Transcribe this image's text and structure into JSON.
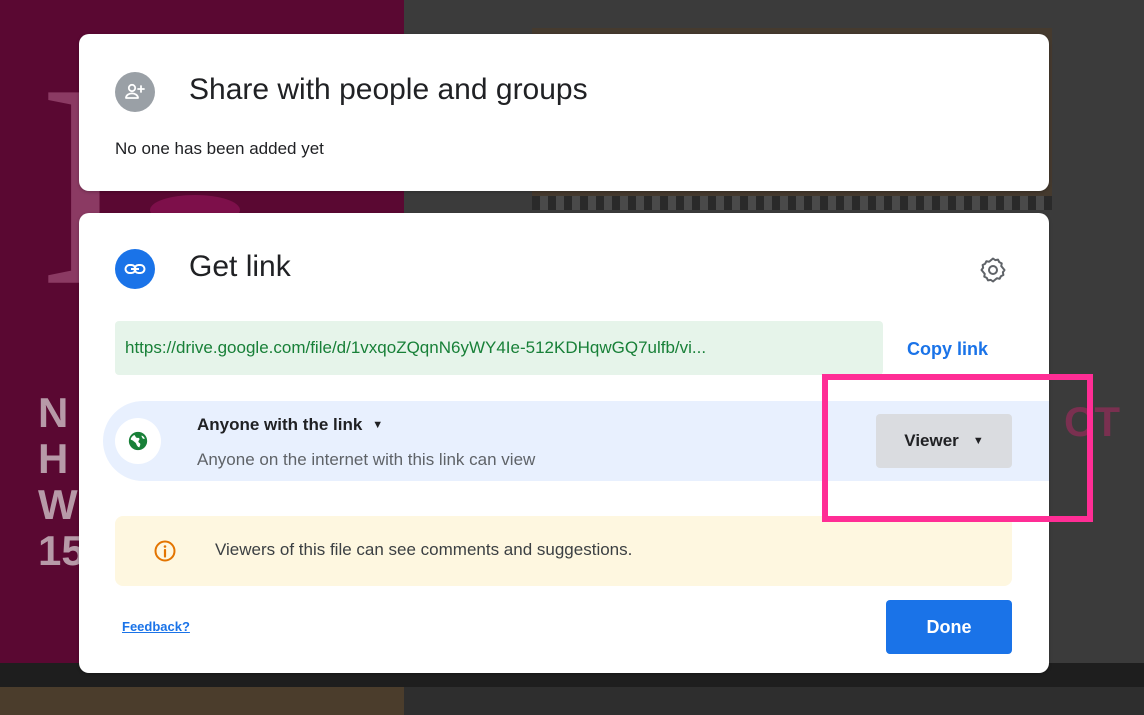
{
  "share": {
    "title": "Share with people and groups",
    "subtitle": "No one has been added yet",
    "avatar_icon": "person-add-icon"
  },
  "link": {
    "title": "Get link",
    "icon": "link-icon",
    "settings_icon": "gear-icon",
    "url": "https://drive.google.com/file/d/1vxqoZQqnN6yWY4Ie-512KDHqwGQ7ulfb/vi...",
    "copy_label": "Copy link",
    "access": {
      "icon": "globe-icon",
      "label": "Anyone with the link",
      "description": "Anyone on the internet with this link can view",
      "role": "Viewer"
    },
    "notice": {
      "icon": "info-icon",
      "text": "Viewers of this file can see comments and suggestions."
    },
    "feedback_label": "Feedback?",
    "done_label": "Done"
  },
  "colors": {
    "accent": "#1a73e8",
    "url_bg": "#e6f4ea",
    "url_text": "#188038",
    "access_bg": "#e8f0fe",
    "notice_bg": "#fef7e0",
    "notice_icon": "#e37400",
    "globe": "#188038",
    "highlight": "#ff2d95"
  },
  "background": {
    "letters": "N H W 15",
    "right_letters": "CT"
  }
}
